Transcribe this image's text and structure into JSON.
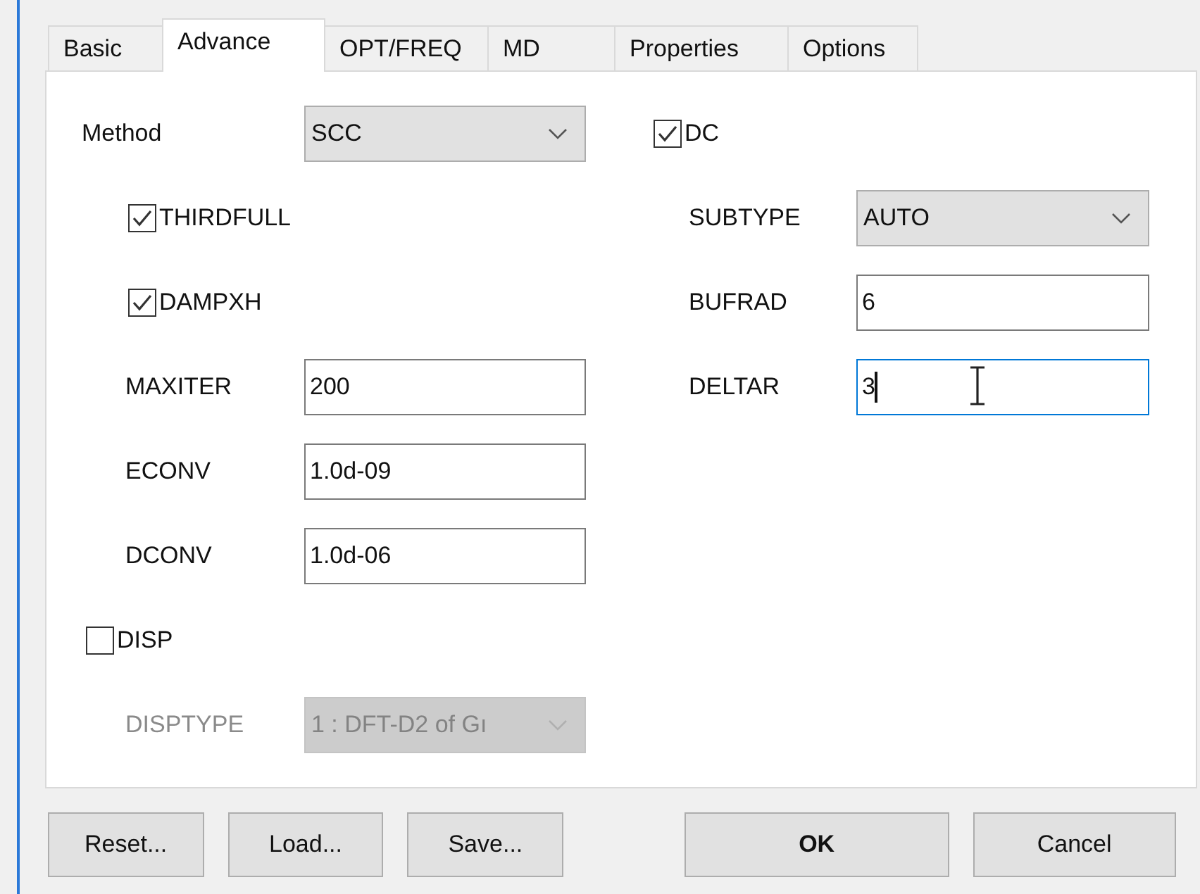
{
  "tabs": [
    {
      "label": "Basic",
      "selected": false
    },
    {
      "label": "Advance",
      "selected": true
    },
    {
      "label": "OPT/FREQ",
      "selected": false
    },
    {
      "label": "MD",
      "selected": false
    },
    {
      "label": "Properties",
      "selected": false
    },
    {
      "label": "Options",
      "selected": false
    }
  ],
  "columns": [
    [
      {
        "kind": "select",
        "label": "Method",
        "value": "SCC",
        "disabled": false,
        "children": [
          {
            "kind": "checkbox",
            "label": "THIRDFULL",
            "checked": true
          },
          {
            "kind": "checkbox",
            "label": "DAMPXH",
            "checked": true
          },
          {
            "kind": "input",
            "label": "MAXITER",
            "value": "200",
            "focused": false
          },
          {
            "kind": "input",
            "label": "ECONV",
            "value": "1.0d-09",
            "focused": false
          },
          {
            "kind": "input",
            "label": "DCONV",
            "value": "1.0d-06",
            "focused": false
          }
        ]
      },
      {
        "kind": "checkbox",
        "label": "DISP",
        "checked": false,
        "children": [
          {
            "kind": "select",
            "label": "DISPTYPE",
            "value": "1 : DFT-D2 of Gı",
            "disabled": true
          }
        ]
      }
    ],
    [
      {
        "kind": "checkbox",
        "label": "DC",
        "checked": true,
        "children": [
          {
            "kind": "select",
            "label": "SUBTYPE",
            "value": "AUTO",
            "disabled": false
          },
          {
            "kind": "input",
            "label": "BUFRAD",
            "value": "6",
            "focused": false
          },
          {
            "kind": "input",
            "label": "DELTAR",
            "value": "3",
            "focused": true
          }
        ]
      }
    ]
  ],
  "buttons": [
    {
      "label": "Reset...",
      "default": false
    },
    {
      "label": "Load...",
      "default": false
    },
    {
      "label": "Save...",
      "default": false
    },
    {
      "label": "OK",
      "default": true
    },
    {
      "label": "Cancel",
      "default": false
    }
  ]
}
